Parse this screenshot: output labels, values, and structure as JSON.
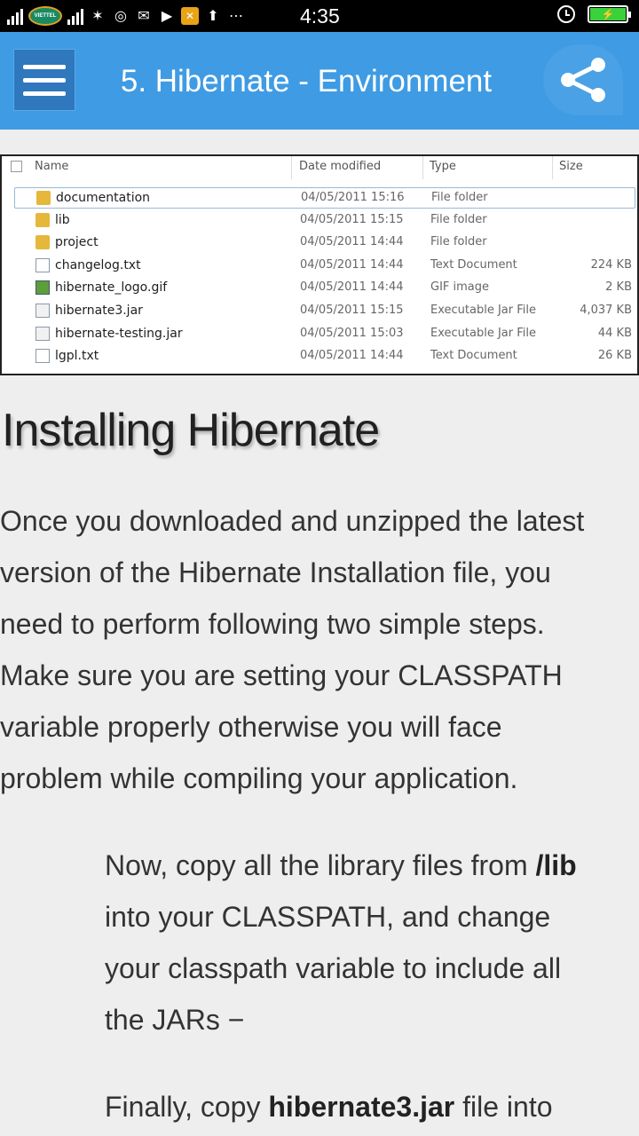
{
  "status_bar": {
    "time": "4:35",
    "carrier": "VIETTEL",
    "battery_color": "#3bd13b"
  },
  "app_bar": {
    "title": "5. Hibernate - Environment",
    "color": "#3f9be3",
    "menu_icon": "hamburger-menu-icon",
    "share_icon": "share-icon"
  },
  "explorer": {
    "columns": [
      "Name",
      "Date modified",
      "Type",
      "Size"
    ],
    "files": [
      {
        "name": "documentation",
        "date": "04/05/2011 15:16",
        "type": "File folder",
        "size": "",
        "icon": "folder"
      },
      {
        "name": "lib",
        "date": "04/05/2011 15:15",
        "type": "File folder",
        "size": "",
        "icon": "folder"
      },
      {
        "name": "project",
        "date": "04/05/2011 14:44",
        "type": "File folder",
        "size": "",
        "icon": "folder"
      },
      {
        "name": "changelog.txt",
        "date": "04/05/2011 14:44",
        "type": "Text Document",
        "size": "224 KB",
        "icon": "doc"
      },
      {
        "name": "hibernate_logo.gif",
        "date": "04/05/2011 14:44",
        "type": "GIF image",
        "size": "2 KB",
        "icon": "gif"
      },
      {
        "name": "hibernate3.jar",
        "date": "04/05/2011 15:15",
        "type": "Executable Jar File",
        "size": "4,037 KB",
        "icon": "jar"
      },
      {
        "name": "hibernate-testing.jar",
        "date": "04/05/2011 15:03",
        "type": "Executable Jar File",
        "size": "44 KB",
        "icon": "jar"
      },
      {
        "name": "lgpl.txt",
        "date": "04/05/2011 14:44",
        "type": "Text Document",
        "size": "26 KB",
        "icon": "doc"
      }
    ]
  },
  "article": {
    "heading": "Installing Hibernate",
    "paragraph_lines": [
      "Once you downloaded and unzipped the latest",
      "version of the Hibernate Installation file, you",
      "need to perform following two simple steps.",
      "Make sure you are setting your CLASSPATH",
      "variable properly otherwise you will face",
      "problem while compiling your application."
    ],
    "step1": {
      "line1_prefix": "Now, copy all the library files from ",
      "line1_bold": "/lib",
      "line2": "into your CLASSPATH, and change",
      "line3": "your classpath variable to include all",
      "line4": "the JARs −"
    },
    "step2": {
      "prefix": "Finally, copy ",
      "bold": "hibernate3.jar",
      "suffix": " file into"
    }
  }
}
